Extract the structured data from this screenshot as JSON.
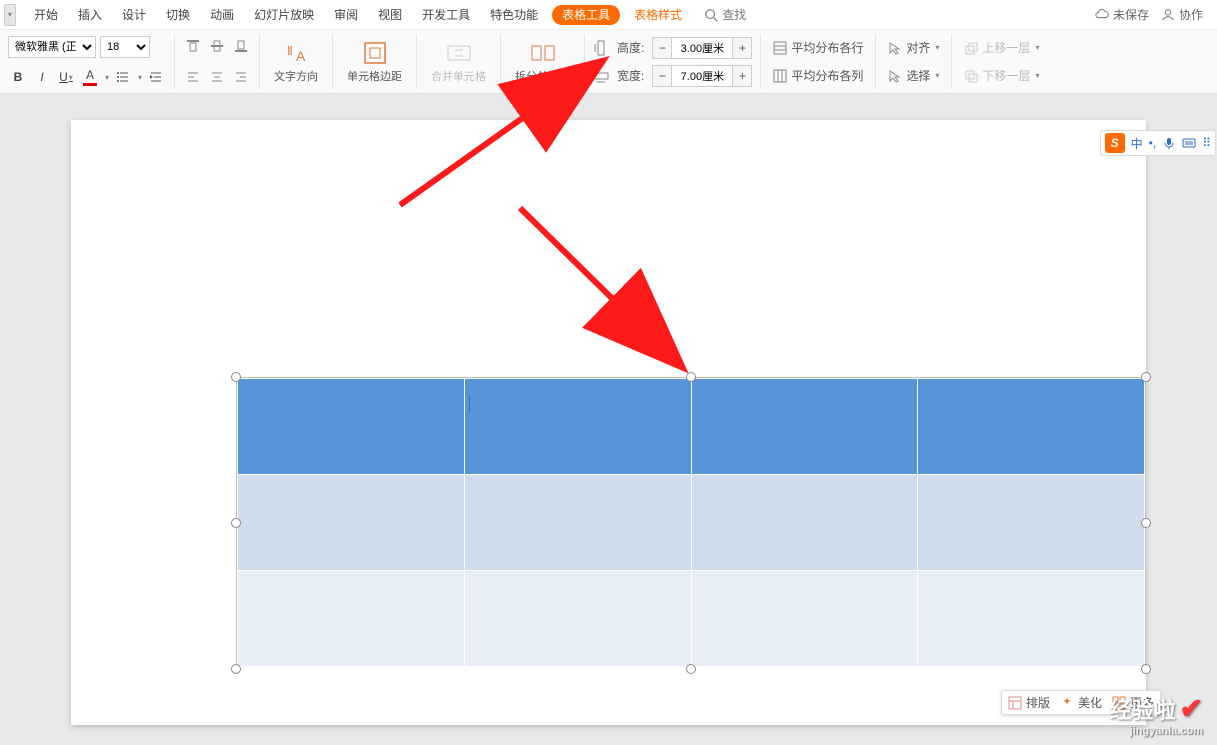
{
  "menu": {
    "items": [
      "开始",
      "插入",
      "设计",
      "切换",
      "动画",
      "幻灯片放映",
      "审阅",
      "视图",
      "开发工具",
      "特色功能"
    ],
    "tableTools": "表格工具",
    "tableStyle": "表格样式",
    "search": "查找",
    "unsaved": "未保存",
    "collab": "协作"
  },
  "ribbon": {
    "fontName": "微软雅黑 (正文)",
    "fontSize": "18",
    "textDirection": "文字方向",
    "cellMargin": "单元格边距",
    "mergeCells": "合并单元格",
    "splitCells": "拆分单元格",
    "heightLabel": "高度:",
    "widthLabel": "宽度:",
    "heightValue": "3.00厘米",
    "widthValue": "7.00厘米",
    "distRows": "平均分布各行",
    "distCols": "平均分布各列",
    "align": "对齐",
    "select": "选择",
    "moveUp": "上移一层",
    "moveDown": "下移一层"
  },
  "ime": {
    "lang": "中"
  },
  "floatTB": {
    "layout": "排版",
    "beautify": "美化",
    "more": "更多"
  },
  "watermark": {
    "main": "经验啦",
    "sub": "jingyanla.com"
  }
}
